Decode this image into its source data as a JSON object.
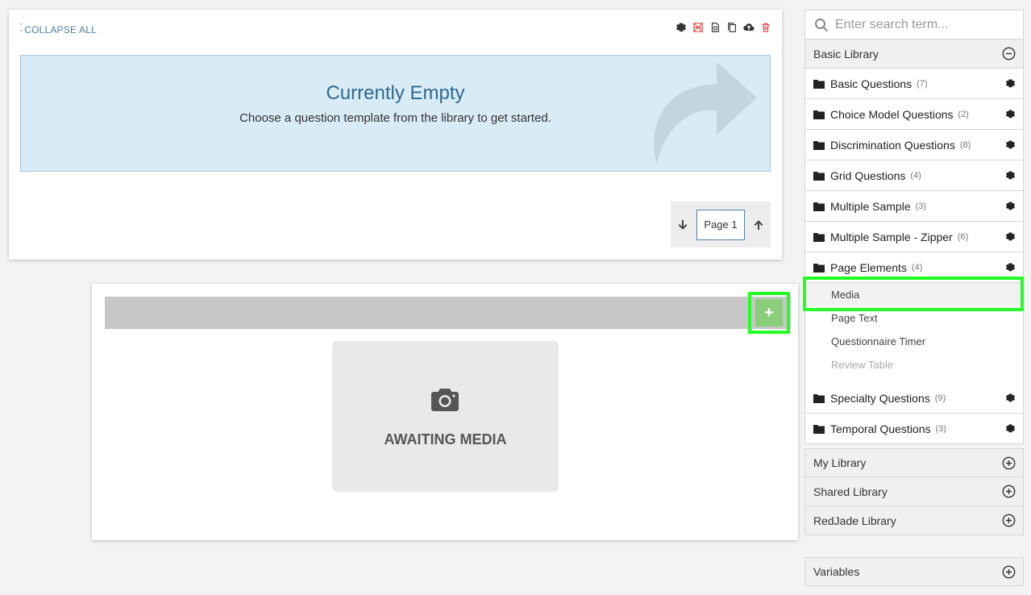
{
  "editor": {
    "collapse_all": "COLLAPSE ALL",
    "empty_title": "Currently Empty",
    "empty_subtitle": "Choose a question template from the library to get started.",
    "page_label": "Page 1"
  },
  "media_block": {
    "add_label": "+",
    "awaiting_label": "AWAITING MEDIA"
  },
  "search": {
    "placeholder": "Enter search term..."
  },
  "libraries": {
    "basic": {
      "label": "Basic Library",
      "categories": [
        {
          "label": "Basic Questions",
          "count": "(7)"
        },
        {
          "label": "Choice Model Questions",
          "count": "(2)"
        },
        {
          "label": "Discrimination Questions",
          "count": "(8)"
        },
        {
          "label": "Grid Questions",
          "count": "(4)"
        },
        {
          "label": "Multiple Sample",
          "count": "(3)"
        },
        {
          "label": "Multiple Sample - Zipper",
          "count": "(6)"
        },
        {
          "label": "Page Elements",
          "count": "(4)"
        },
        {
          "label": "Specialty Questions",
          "count": "(9)"
        },
        {
          "label": "Temporal Questions",
          "count": "(3)"
        }
      ],
      "page_elements": [
        "Media",
        "Page Text",
        "Questionnaire Timer",
        "Review Table"
      ]
    },
    "my": "My Library",
    "shared": "Shared Library",
    "redjade": "RedJade Library",
    "variables": "Variables"
  },
  "colors": {
    "accent_blue": "#2e6a90",
    "empty_bg": "#d9ebf5",
    "add_green": "#8acd7a",
    "highlight": "#22ff22",
    "delete_red": "#d9534f"
  }
}
